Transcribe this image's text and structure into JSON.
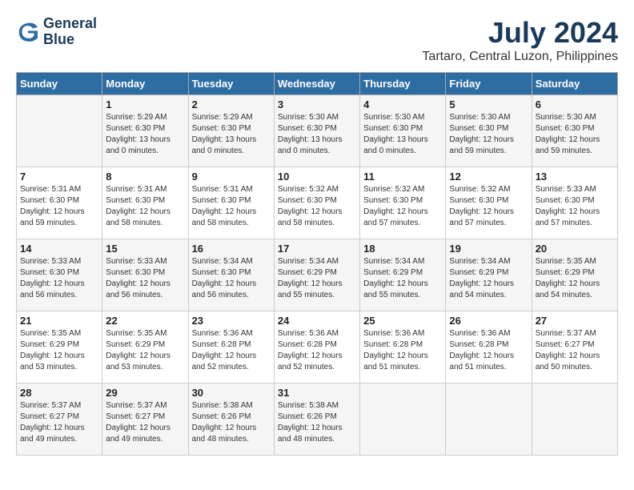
{
  "header": {
    "logo_line1": "General",
    "logo_line2": "Blue",
    "month_year": "July 2024",
    "location": "Tartaro, Central Luzon, Philippines"
  },
  "weekdays": [
    "Sunday",
    "Monday",
    "Tuesday",
    "Wednesday",
    "Thursday",
    "Friday",
    "Saturday"
  ],
  "weeks": [
    [
      {
        "day": "",
        "info": ""
      },
      {
        "day": "1",
        "info": "Sunrise: 5:29 AM\nSunset: 6:30 PM\nDaylight: 13 hours\nand 0 minutes."
      },
      {
        "day": "2",
        "info": "Sunrise: 5:29 AM\nSunset: 6:30 PM\nDaylight: 13 hours\nand 0 minutes."
      },
      {
        "day": "3",
        "info": "Sunrise: 5:30 AM\nSunset: 6:30 PM\nDaylight: 13 hours\nand 0 minutes."
      },
      {
        "day": "4",
        "info": "Sunrise: 5:30 AM\nSunset: 6:30 PM\nDaylight: 13 hours\nand 0 minutes."
      },
      {
        "day": "5",
        "info": "Sunrise: 5:30 AM\nSunset: 6:30 PM\nDaylight: 12 hours\nand 59 minutes."
      },
      {
        "day": "6",
        "info": "Sunrise: 5:30 AM\nSunset: 6:30 PM\nDaylight: 12 hours\nand 59 minutes."
      }
    ],
    [
      {
        "day": "7",
        "info": "Sunrise: 5:31 AM\nSunset: 6:30 PM\nDaylight: 12 hours\nand 59 minutes."
      },
      {
        "day": "8",
        "info": "Sunrise: 5:31 AM\nSunset: 6:30 PM\nDaylight: 12 hours\nand 58 minutes."
      },
      {
        "day": "9",
        "info": "Sunrise: 5:31 AM\nSunset: 6:30 PM\nDaylight: 12 hours\nand 58 minutes."
      },
      {
        "day": "10",
        "info": "Sunrise: 5:32 AM\nSunset: 6:30 PM\nDaylight: 12 hours\nand 58 minutes."
      },
      {
        "day": "11",
        "info": "Sunrise: 5:32 AM\nSunset: 6:30 PM\nDaylight: 12 hours\nand 57 minutes."
      },
      {
        "day": "12",
        "info": "Sunrise: 5:32 AM\nSunset: 6:30 PM\nDaylight: 12 hours\nand 57 minutes."
      },
      {
        "day": "13",
        "info": "Sunrise: 5:33 AM\nSunset: 6:30 PM\nDaylight: 12 hours\nand 57 minutes."
      }
    ],
    [
      {
        "day": "14",
        "info": "Sunrise: 5:33 AM\nSunset: 6:30 PM\nDaylight: 12 hours\nand 56 minutes."
      },
      {
        "day": "15",
        "info": "Sunrise: 5:33 AM\nSunset: 6:30 PM\nDaylight: 12 hours\nand 56 minutes."
      },
      {
        "day": "16",
        "info": "Sunrise: 5:34 AM\nSunset: 6:30 PM\nDaylight: 12 hours\nand 56 minutes."
      },
      {
        "day": "17",
        "info": "Sunrise: 5:34 AM\nSunset: 6:29 PM\nDaylight: 12 hours\nand 55 minutes."
      },
      {
        "day": "18",
        "info": "Sunrise: 5:34 AM\nSunset: 6:29 PM\nDaylight: 12 hours\nand 55 minutes."
      },
      {
        "day": "19",
        "info": "Sunrise: 5:34 AM\nSunset: 6:29 PM\nDaylight: 12 hours\nand 54 minutes."
      },
      {
        "day": "20",
        "info": "Sunrise: 5:35 AM\nSunset: 6:29 PM\nDaylight: 12 hours\nand 54 minutes."
      }
    ],
    [
      {
        "day": "21",
        "info": "Sunrise: 5:35 AM\nSunset: 6:29 PM\nDaylight: 12 hours\nand 53 minutes."
      },
      {
        "day": "22",
        "info": "Sunrise: 5:35 AM\nSunset: 6:29 PM\nDaylight: 12 hours\nand 53 minutes."
      },
      {
        "day": "23",
        "info": "Sunrise: 5:36 AM\nSunset: 6:28 PM\nDaylight: 12 hours\nand 52 minutes."
      },
      {
        "day": "24",
        "info": "Sunrise: 5:36 AM\nSunset: 6:28 PM\nDaylight: 12 hours\nand 52 minutes."
      },
      {
        "day": "25",
        "info": "Sunrise: 5:36 AM\nSunset: 6:28 PM\nDaylight: 12 hours\nand 51 minutes."
      },
      {
        "day": "26",
        "info": "Sunrise: 5:36 AM\nSunset: 6:28 PM\nDaylight: 12 hours\nand 51 minutes."
      },
      {
        "day": "27",
        "info": "Sunrise: 5:37 AM\nSunset: 6:27 PM\nDaylight: 12 hours\nand 50 minutes."
      }
    ],
    [
      {
        "day": "28",
        "info": "Sunrise: 5:37 AM\nSunset: 6:27 PM\nDaylight: 12 hours\nand 49 minutes."
      },
      {
        "day": "29",
        "info": "Sunrise: 5:37 AM\nSunset: 6:27 PM\nDaylight: 12 hours\nand 49 minutes."
      },
      {
        "day": "30",
        "info": "Sunrise: 5:38 AM\nSunset: 6:26 PM\nDaylight: 12 hours\nand 48 minutes."
      },
      {
        "day": "31",
        "info": "Sunrise: 5:38 AM\nSunset: 6:26 PM\nDaylight: 12 hours\nand 48 minutes."
      },
      {
        "day": "",
        "info": ""
      },
      {
        "day": "",
        "info": ""
      },
      {
        "day": "",
        "info": ""
      }
    ]
  ]
}
